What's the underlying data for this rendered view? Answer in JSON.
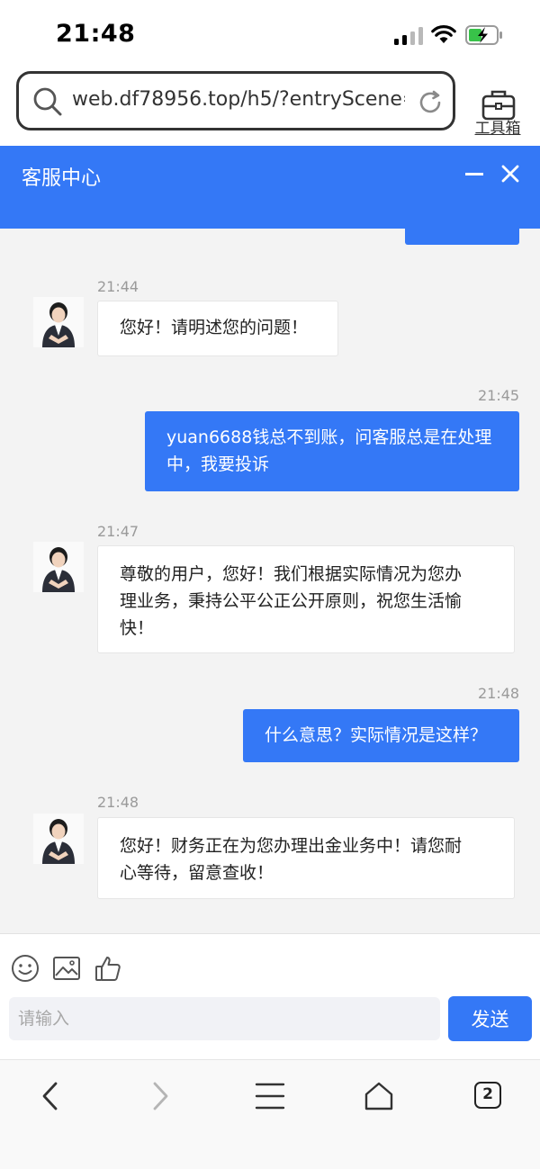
{
  "status_bar": {
    "time": "21:48"
  },
  "browser": {
    "url": "web.df78956.top/h5/?entryScene=...",
    "toolbox_label": "工具箱",
    "tabs_count": "2"
  },
  "header": {
    "title": "客服中心"
  },
  "messages": [
    {
      "time": "21:44",
      "direction": "incoming",
      "text": "您好！请明述您的问题！"
    },
    {
      "time": "21:45",
      "direction": "outgoing",
      "lines": [
        "yuan6688钱总不到账，问客服总是在处理",
        "中，我要投诉"
      ]
    },
    {
      "time": "21:47",
      "direction": "incoming",
      "lines": [
        "尊敬的用户，您好！我们根据实际情况为您办",
        "理业务，秉持公平公正公开原则，祝您生活愉",
        "快！"
      ]
    },
    {
      "time": "21:48",
      "direction": "outgoing",
      "text": "什么意思？实际情况是这样？"
    },
    {
      "time": "21:48",
      "direction": "incoming",
      "lines": [
        "您好！财务正在为您办理出金业务中！请您耐",
        "心等待，留意查收！"
      ]
    }
  ],
  "composer": {
    "placeholder": "请输入",
    "send_label": "发送"
  },
  "colors": {
    "accent": "#3478f6",
    "chat_background": "#f3f3f3"
  }
}
